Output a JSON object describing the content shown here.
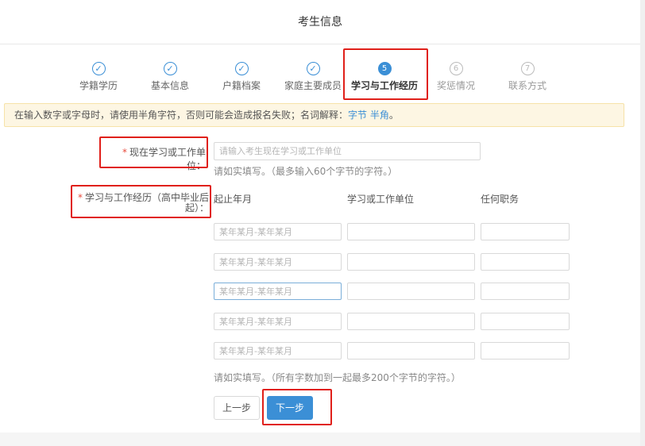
{
  "page": {
    "title": "考生信息"
  },
  "steps": [
    {
      "label": "学籍学历",
      "status": "done",
      "icon": "✓"
    },
    {
      "label": "基本信息",
      "status": "done",
      "icon": "✓"
    },
    {
      "label": "户籍档案",
      "status": "done",
      "icon": "✓"
    },
    {
      "label": "家庭主要成员",
      "status": "done",
      "icon": "✓"
    },
    {
      "label": "学习与工作经历",
      "status": "active",
      "icon": "5"
    },
    {
      "label": "奖惩情况",
      "status": "todo",
      "icon": "6"
    },
    {
      "label": "联系方式",
      "status": "todo",
      "icon": "7"
    }
  ],
  "notice": {
    "text": "在输入数字或字母时，请使用半角字符，否则可能会造成报名失败；名词解释：",
    "link1": "字节",
    "link2": "半角",
    "end": "。"
  },
  "current_unit": {
    "required_mark": "*",
    "label": "现在学习或工作单位：",
    "placeholder": "请输入考生现在学习或工作单位",
    "hint": "请如实填写。（最多输入60个字节的字符。）"
  },
  "history": {
    "required_mark": "*",
    "label": "学习与工作经历（高中毕业后起）：",
    "columns": [
      "起止年月",
      "学习或工作单位",
      "任何职务"
    ],
    "period_placeholder": "某年某月-某年某月",
    "hint": "请如实填写。（所有字数加到一起最多200个字节的字符。）"
  },
  "buttons": {
    "prev": "上一步",
    "next": "下一步"
  },
  "colors": {
    "accent": "#3b8fd6",
    "required": "#e84a3c",
    "highlight": "#e0201a"
  }
}
